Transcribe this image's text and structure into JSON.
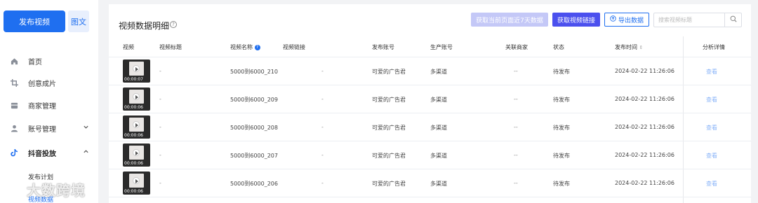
{
  "sidebar": {
    "publish_video": "发布视频",
    "image_text": "图文",
    "items": [
      {
        "label": "首页",
        "icon": "home-icon"
      },
      {
        "label": "创意成片",
        "icon": "crop-icon"
      },
      {
        "label": "商家管理",
        "icon": "store-icon"
      },
      {
        "label": "账号管理",
        "icon": "user-icon",
        "chevron": "down"
      },
      {
        "label": "抖音投放",
        "icon": "douyin-icon",
        "chevron": "up"
      }
    ],
    "sub_items": [
      "发布计划",
      "视频数据"
    ]
  },
  "watermark": "大数跨境",
  "main": {
    "title": "视频数据明细",
    "buttons": {
      "fetch_recent": "获取当前页面近7天数据",
      "fetch_link": "获取视频链接",
      "export": "导出数据"
    },
    "search_placeholder": "搜索视频标题",
    "columns": [
      "视频",
      "视频标题",
      "视频名称",
      "视频链接",
      "发布账号",
      "生产账号",
      "关联商家",
      "状态",
      "发布时间",
      "分析详情"
    ],
    "rows": [
      {
        "duration": "00:00:07",
        "title": "-",
        "name": "5000到6000_210",
        "link": "-",
        "account": "可爱的广告君",
        "producer": "多渠道",
        "merchant": "--",
        "status": "待发布",
        "time": "2024-02-22 11:26:06",
        "action": "查看"
      },
      {
        "duration": "00:00:06",
        "title": "-",
        "name": "5000到6000_209",
        "link": "-",
        "account": "可爱的广告君",
        "producer": "多渠道",
        "merchant": "--",
        "status": "待发布",
        "time": "2024-02-22 11:26:06",
        "action": "查看"
      },
      {
        "duration": "00:00:06",
        "title": "-",
        "name": "5000到6000_208",
        "link": "-",
        "account": "可爱的广告君",
        "producer": "多渠道",
        "merchant": "--",
        "status": "待发布",
        "time": "2024-02-22 11:26:06",
        "action": "查看"
      },
      {
        "duration": "00:00:06",
        "title": "-",
        "name": "5000到6000_207",
        "link": "-",
        "account": "可爱的广告君",
        "producer": "多渠道",
        "merchant": "--",
        "status": "待发布",
        "time": "2024-02-22 11:26:06",
        "action": "查看"
      },
      {
        "duration": "00:00:06",
        "title": "-",
        "name": "5000到6000_206",
        "link": "-",
        "account": "可爱的广告君",
        "producer": "多渠道",
        "merchant": "--",
        "status": "待发布",
        "time": "2024-02-22 11:26:06",
        "action": "查看"
      }
    ]
  },
  "colors": {
    "primary": "#1f6ff0",
    "purple": "#4b50ee",
    "purple_disabled": "#c4c8f7",
    "link_light": "#8ab4f8"
  }
}
